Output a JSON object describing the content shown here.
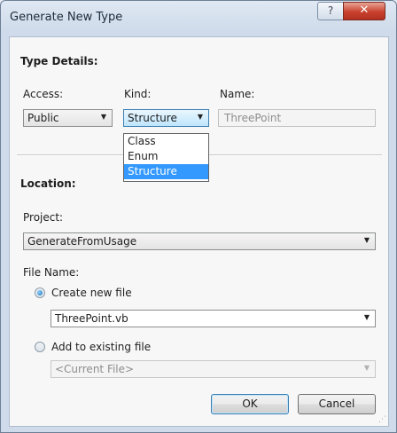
{
  "window": {
    "title": "Generate New Type",
    "help_glyph": "?",
    "close_glyph": "✕"
  },
  "type_details": {
    "header": "Type Details:",
    "access": {
      "label": "Access:",
      "value": "Public"
    },
    "kind": {
      "label": "Kind:",
      "value": "Structure",
      "options": [
        "Class",
        "Enum",
        "Structure"
      ],
      "highlighted": "Structure"
    },
    "name": {
      "label": "Name:",
      "value": "ThreePoint"
    }
  },
  "location": {
    "header": "Location:",
    "project": {
      "label": "Project:",
      "value": "GenerateFromUsage"
    },
    "file_name": {
      "label": "File Name:",
      "create_new": {
        "label": "Create new file",
        "selected": true,
        "value": "ThreePoint.vb"
      },
      "add_existing": {
        "label": "Add to existing file",
        "selected": false,
        "value": "<Current File>"
      }
    }
  },
  "buttons": {
    "ok": "OK",
    "cancel": "Cancel"
  },
  "icons": {
    "dropdown": "▼"
  }
}
